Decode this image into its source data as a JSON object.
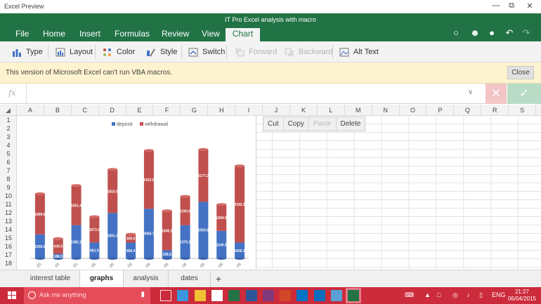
{
  "window": {
    "app_title": "Excel Preview",
    "doc_title": "IT Pro Excel analysis with macro",
    "controls": [
      "—",
      "⧉",
      "✕"
    ]
  },
  "ribbon": {
    "tabs": [
      "File",
      "Home",
      "Insert",
      "Formulas",
      "Review",
      "View",
      "Chart"
    ],
    "active_tab": "Chart",
    "right_icons": [
      "lightbulb-icon",
      "smiley-icon",
      "share-person-icon",
      "undo-icon",
      "redo-icon"
    ],
    "chart_tools": [
      {
        "label": "Type",
        "icon": "chart-type-icon",
        "enabled": true
      },
      {
        "label": "Layout",
        "icon": "layout-icon",
        "enabled": true
      },
      {
        "label": "Color",
        "icon": "color-icon",
        "enabled": true
      },
      {
        "label": "Style",
        "icon": "style-icon",
        "enabled": true
      },
      {
        "label": "Switch",
        "icon": "switch-icon",
        "enabled": true
      },
      {
        "label": "Forward",
        "icon": "forward-icon",
        "enabled": false
      },
      {
        "label": "Backward",
        "icon": "backward-icon",
        "enabled": false
      },
      {
        "label": "Alt Text",
        "icon": "alt-text-icon",
        "enabled": true
      }
    ]
  },
  "message_bar": {
    "text": "This version of Microsoft Excel can't run VBA macros.",
    "close_label": "Close"
  },
  "formula_bar": {
    "fx_label": "fx",
    "value": ""
  },
  "columns": [
    "A",
    "B",
    "C",
    "D",
    "E",
    "F",
    "G",
    "H",
    "I",
    "J",
    "K",
    "L",
    "M",
    "N",
    "O",
    "P",
    "Q",
    "R",
    "S"
  ],
  "rows": [
    "1",
    "2",
    "3",
    "4",
    "5",
    "6",
    "7",
    "8",
    "9",
    "10",
    "11",
    "12",
    "13",
    "14",
    "15",
    "16",
    "17",
    "18"
  ],
  "context_menu": {
    "items": [
      {
        "label": "Cut",
        "enabled": true
      },
      {
        "label": "Copy",
        "enabled": true
      },
      {
        "label": "Paste",
        "enabled": false
      },
      {
        "label": "Delete",
        "enabled": true
      }
    ]
  },
  "chart_data": {
    "type": "bar",
    "stacked": true,
    "legend_position": "top",
    "categories": [
      "05",
      "05",
      "05",
      "06",
      "06",
      "06",
      "06",
      "06",
      "06",
      "06",
      "06",
      "06"
    ],
    "series": [
      {
        "name": "deposit",
        "color": "#4472c4",
        "values": [
          1000,
          188,
          1381,
          661,
          1891,
          656,
          2065,
          338,
          1379,
          2354,
          1146,
          656
        ],
        "labels": [
          "1000.5",
          "188.5",
          "1381.2",
          "661.5",
          "1891.4",
          "656.4",
          "2065.7",
          "338.5",
          "1379.2",
          "2354.8",
          "1146.5",
          "1656.3"
        ]
      },
      {
        "name": "withdrawal",
        "color": "#c0504d",
        "values": [
          1689,
          634,
          1651,
          1073,
          1810,
          350,
          2423,
          1640,
          1200,
          2177,
          1094,
          3192
        ],
        "labels": [
          "1689.6",
          "634.5",
          "1651.4",
          "1073.1",
          "1810.0",
          "350.0",
          "2423.0",
          "1640.1",
          "1200.0",
          "2177.2",
          "1094.5",
          "3192.2"
        ]
      }
    ],
    "ylim": [
      0,
      5200
    ],
    "grid": false
  },
  "sheet_tabs": [
    "interest table",
    "graphs",
    "analysis",
    "dates"
  ],
  "active_sheet": "graphs",
  "add_sheet_label": "+",
  "taskbar": {
    "search_placeholder": "Ask me anything",
    "time": "21:27",
    "date": "06/04/2015",
    "lang": "ENG",
    "app_icons": [
      "task-view-icon",
      "edge-icon",
      "explorer-icon",
      "store-icon",
      "excel-icon",
      "word-icon",
      "onenote-icon",
      "powerpoint-icon",
      "outlook-icon",
      "mail-icon",
      "photos-icon",
      "excel-active-icon"
    ]
  }
}
